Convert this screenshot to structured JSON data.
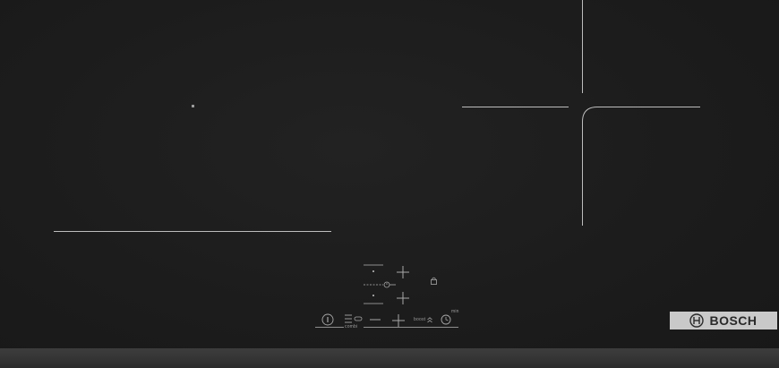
{
  "controls": {
    "boost_label": "boost",
    "combi_label": "combi",
    "min_label": "min"
  },
  "brand": {
    "name": "BOSCH"
  },
  "colors": {
    "glass": "#1c1c1c",
    "zone_marking": "#bdbdbd",
    "control_symbols": "#a8a8a8",
    "badge": "#c9c9c9",
    "badge_text": "#2a2a2a",
    "frame": "#353535"
  },
  "icons": {
    "info": "info-icon",
    "combi": "combi-zone-icon",
    "minus": "minus-icon",
    "plus": "plus-icon",
    "boost": "boost-chevron-icon",
    "timer": "timer-icon",
    "lock": "child-lock-icon",
    "zone_timer": "zone-timer-icon",
    "brand_logo": "bosch-logo-icon"
  }
}
